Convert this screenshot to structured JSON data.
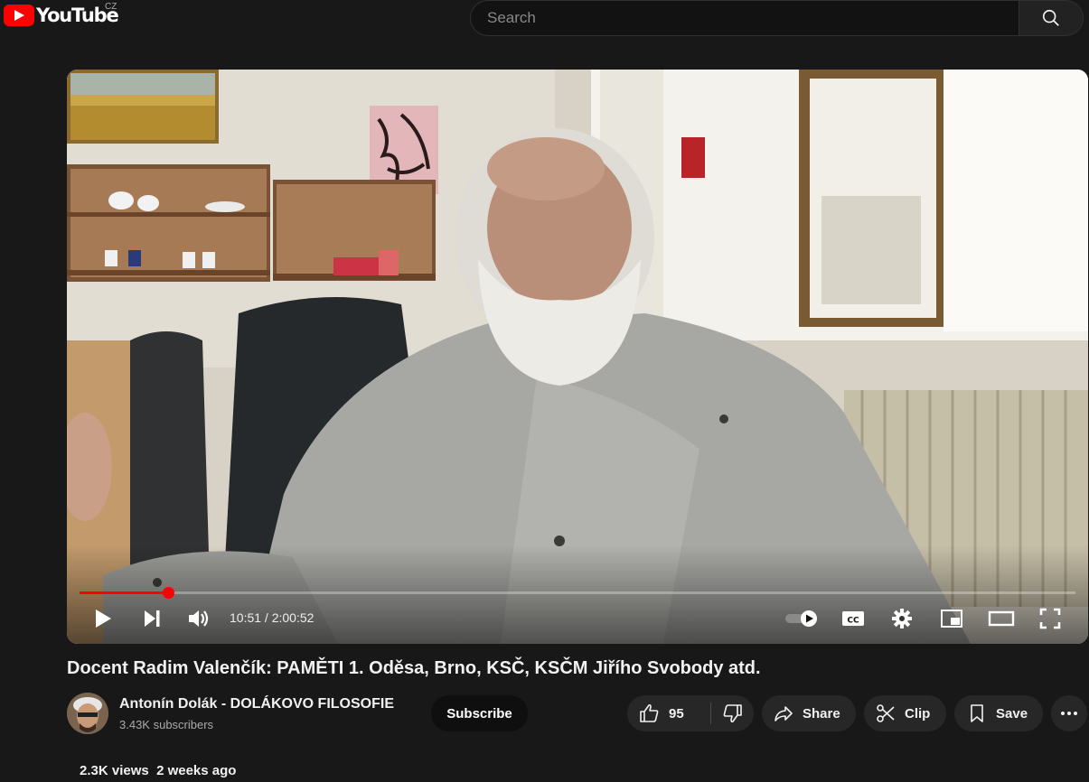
{
  "header": {
    "logo_text": "YouTube",
    "region": "CZ",
    "search_placeholder": "Search"
  },
  "player": {
    "current_time": "10:51",
    "duration": "2:00:52",
    "time_display": "10:51 / 2:00:52",
    "progress_fraction": 0.089
  },
  "video": {
    "title": "Docent Radim Valenčík: PAMĚTI 1. Oděsa, Brno, KSČ, KSČM Jiřího Svobody atd.",
    "views": "2.3K views",
    "posted": "2 weeks ago"
  },
  "channel": {
    "name": "Antonín Dolák - DOLÁKOVO FILOSOFIE",
    "subscribers": "3.43K subscribers",
    "subscribe_label": "Subscribe"
  },
  "actions": {
    "likes": "95",
    "share_label": "Share",
    "clip_label": "Clip",
    "save_label": "Save"
  },
  "colors": {
    "brand_red": "#ff0000",
    "background": "#181818",
    "pill_bg": "#272727"
  }
}
